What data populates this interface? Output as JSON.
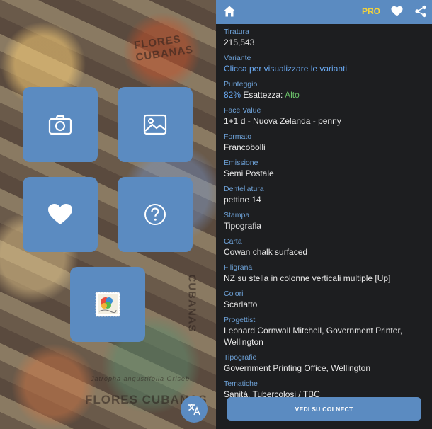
{
  "background_stamp_text": [
    "FLORES CUBANAS",
    "FLORES CUBANAS",
    "Jatropha angustifolia Griseb.",
    "CUBANAS"
  ],
  "tiles": [
    {
      "name": "camera",
      "icon": "camera-icon"
    },
    {
      "name": "gallery",
      "icon": "image-icon"
    },
    {
      "name": "favorites",
      "icon": "heart-icon"
    },
    {
      "name": "help",
      "icon": "question-icon"
    },
    {
      "name": "colnect",
      "icon": "stamp-logo-icon"
    }
  ],
  "topbar": {
    "pro_label": "PRO"
  },
  "fields": [
    {
      "label": "Tiratura",
      "value": "215,543"
    },
    {
      "label": "Variante",
      "value": "Clicca per visualizzare le varianti"
    },
    {
      "label": "Punteggio",
      "pct": "82%",
      "exact_label": " Esattezza: ",
      "exact_value": "Alto"
    },
    {
      "label": "Face Value",
      "value": "1+1 d - Nuova Zelanda - penny"
    },
    {
      "label": "Formato",
      "value": "Francobolli"
    },
    {
      "label": "Emissione",
      "value": "Semi Postale"
    },
    {
      "label": "Dentellatura",
      "value": "pettine 14"
    },
    {
      "label": "Stampa",
      "value": "Tipografia"
    },
    {
      "label": "Carta",
      "value": "Cowan chalk surfaced"
    },
    {
      "label": "Filigrana",
      "value": "NZ su stella in colonne verticali multiple [Up]"
    },
    {
      "label": "Colori",
      "value": "Scarlatto"
    },
    {
      "label": "Progettisti",
      "value": "Leonard Cornwall Mitchell, Government Printer, Wellington"
    },
    {
      "label": "Tipografie",
      "value": "Government Printing Office, Wellington"
    },
    {
      "label": "Tematiche",
      "value": "Sanità, Tubercolosi / TBC"
    }
  ],
  "cta_label": "VEDI SU COLNECT",
  "colors": {
    "accent": "#5b8bc1",
    "pro": "#f5d33a",
    "label": "#6ea2d8",
    "link": "#69a8f0",
    "alto": "#6cc46a"
  }
}
